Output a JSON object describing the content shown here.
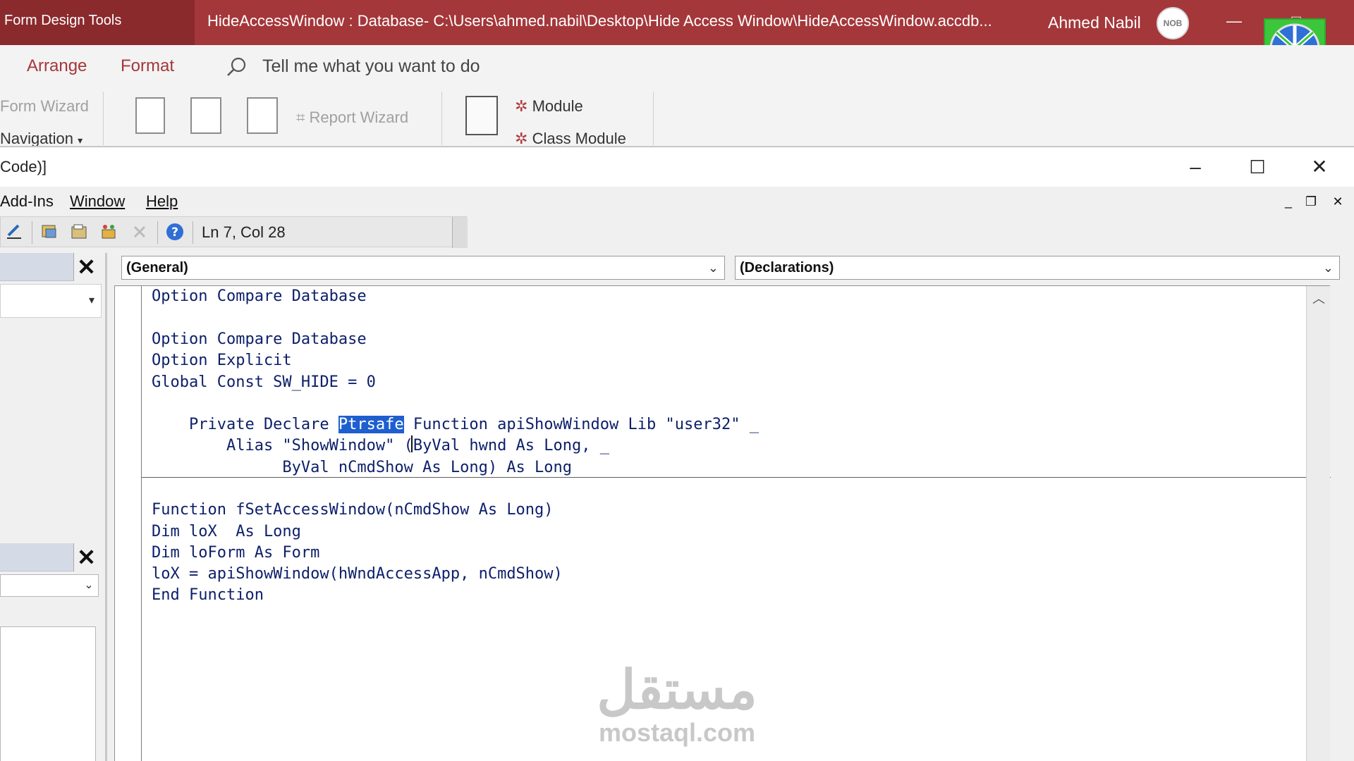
{
  "access": {
    "context_tab": "Form Design Tools",
    "title": "HideAccessWindow : Database- C:\\Users\\ahmed.nabil\\Desktop\\Hide Access Window\\HideAccessWindow.accdb...",
    "user_name": "Ahmed Nabil",
    "avatar_text": "NOB",
    "minimize": "—",
    "restore": "□"
  },
  "ribbon": {
    "tabs": [
      "Arrange",
      "Format"
    ],
    "tell_me": "Tell me what you want to do",
    "form_wizard": "Form Wizard",
    "navigation": "Navigation",
    "report_wizard": "Report Wizard",
    "module": "Module",
    "class_module": "Class Module"
  },
  "vbe": {
    "title": "Code)]",
    "menu": {
      "addins": "Add-Ins",
      "window": "Window",
      "help": "Help"
    },
    "status": "Ln 7, Col 28",
    "combo_object": "(General)",
    "combo_procedure": "(Declarations)"
  },
  "code": {
    "l1": "Option Compare Database",
    "l2": "Option Compare Database",
    "l3": "Option Explicit",
    "l4": "Global Const SW_HIDE = 0",
    "l5_pre": "    Private Declare ",
    "l5_sel": "Ptrsafe",
    "l5_post": " Function apiShowWindow Lib \"user32\" _",
    "l6": "        Alias \"ShowWindow\" (ByVal hwnd As Long, _",
    "l7": "              ByVal nCmdShow As Long) As Long",
    "l8": "Function fSetAccessWindow(nCmdShow As Long)",
    "l9": "Dim loX  As Long",
    "l10": "Dim loForm As Form",
    "l11": "loX = apiShowWindow(hWndAccessApp, nCmdShow)",
    "l12": "End Function"
  },
  "watermark": {
    "arabic": "مستقل",
    "latin": "mostaql.com"
  },
  "colors": {
    "access_red": "#a4373a",
    "code_blue": "#0c1f6a",
    "selection": "#1e5fcf"
  }
}
